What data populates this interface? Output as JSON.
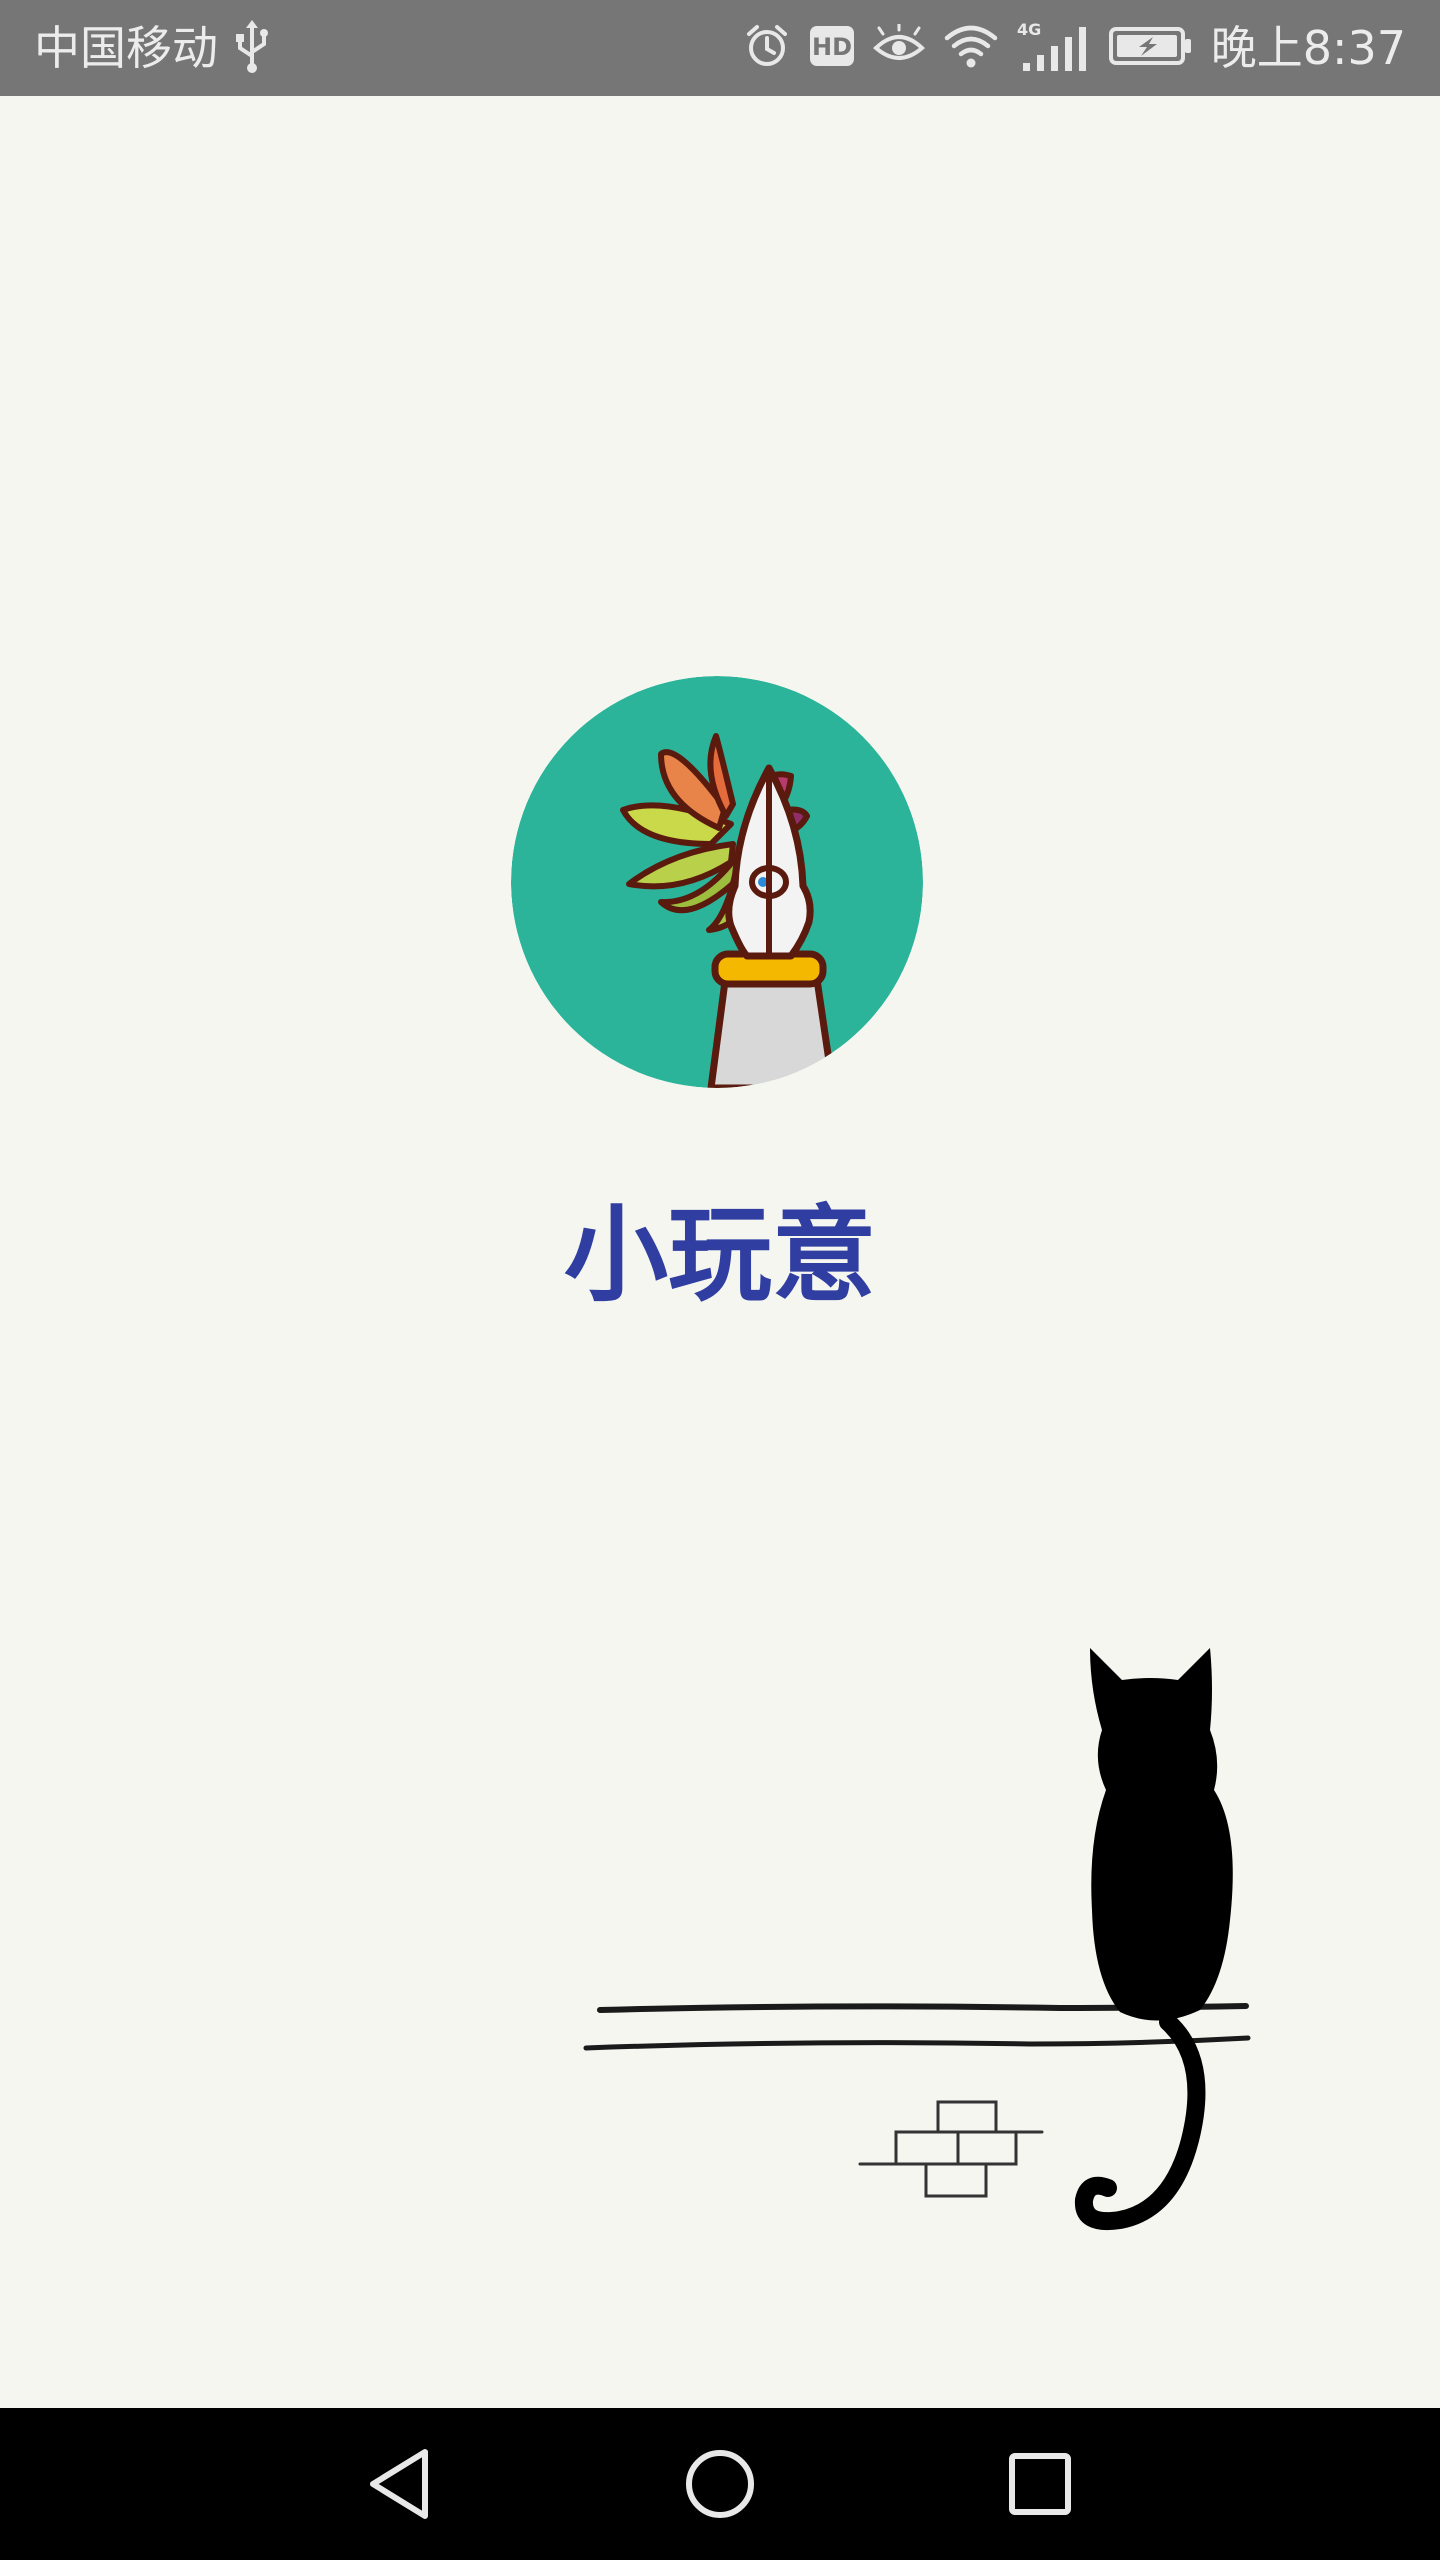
{
  "status_bar": {
    "carrier": "中国移动",
    "time": "晚上8:37",
    "icons": [
      "usb-icon",
      "alarm-icon",
      "hd-icon",
      "eye-icon",
      "wifi-icon",
      "4g-signal-icon",
      "battery-charging-icon"
    ],
    "hd_label": "HD",
    "network_label": "4G"
  },
  "splash": {
    "app_name": "小玩意",
    "app_name_color": "#2f3ea0",
    "logo_bg_color": "#2bb49a",
    "illustration": "cat-on-wall"
  },
  "nav_bar": {
    "buttons": [
      "back-icon",
      "home-icon",
      "recent-apps-icon"
    ]
  }
}
